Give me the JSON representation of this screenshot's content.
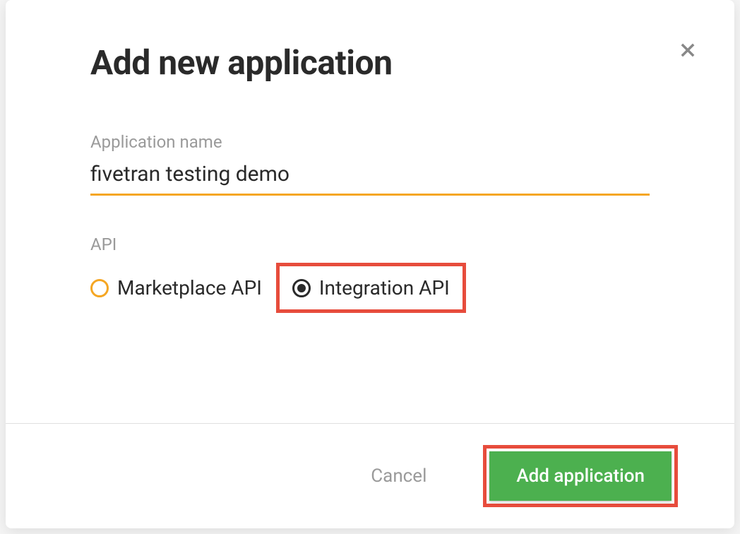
{
  "modal": {
    "title": "Add new application",
    "fields": {
      "app_name": {
        "label": "Application name",
        "value": "fivetran testing demo"
      },
      "api": {
        "label": "API",
        "options": {
          "marketplace": "Marketplace API",
          "integration": "Integration API"
        },
        "selected": "integration"
      }
    },
    "footer": {
      "cancel_label": "Cancel",
      "submit_label": "Add application"
    }
  }
}
